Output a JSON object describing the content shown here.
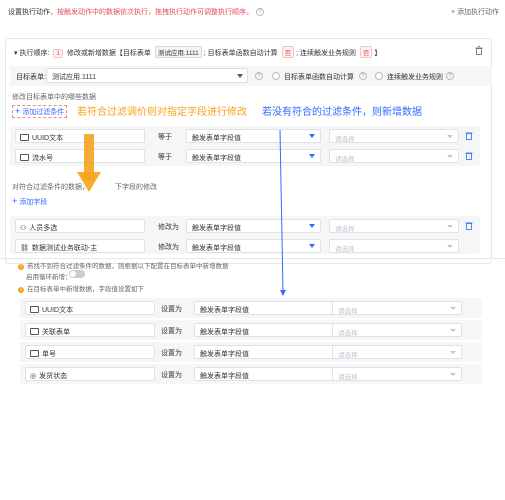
{
  "header": {
    "title": "设置执行动作",
    "warning": "，按触发动作中的数据依次执行，拖拽执行动作可调整执行顺序。",
    "add_action": "+ 添加执行动作"
  },
  "action": {
    "order_label": "执行顺序",
    "order_value": "1",
    "summary_prefix": "修改或新增数据【目标表单",
    "table_tag": "测试应用.1111",
    "summary_mid": "; 目标表单函数自动计算",
    "bool_tag": "否",
    "summary_mid2": "; 连续触发业务规则",
    "bool_tag2": "否",
    "summary_end": "】",
    "target_label": "目标表单:",
    "target_value": "测试应用.1111",
    "opt_calc": "目标表单函数自动计算",
    "opt_chain": "连续触发业务规则",
    "filter_label": "修改目标表单中的哪些数据",
    "add_filter": "添加过滤条件",
    "filters": [
      {
        "field": "UUID文本",
        "op": "等于",
        "value": "触发表单字段值",
        "placeholder": "请选择"
      },
      {
        "field": "流水号",
        "op": "等于",
        "value": "触发表单字段值",
        "placeholder": "请选择"
      }
    ],
    "modify_label": "对符合过滤条件的数据，",
    "modify_label2": "下字段的修改",
    "add_field": "添加字段",
    "mods": [
      {
        "field": "人员多选",
        "op": "修改为",
        "value": "触发表单字段值",
        "placeholder": "请选择"
      },
      {
        "field": "数据测试业务联动-主",
        "op": "修改为",
        "value": "触发表单字段值",
        "placeholder": "请选择"
      }
    ]
  },
  "bottom": {
    "line1": "若找不到符合过滤条件的数据，则根据以下配置在目标表单中新增数据",
    "loop_label": "启用循环新增：",
    "line2": "在目标表单中新增数据，字段值设置如下",
    "rows": [
      {
        "field": "UUID文本",
        "op": "设置为",
        "value": "触发表单字段值",
        "placeholder": "请选择"
      },
      {
        "field": "关联表单",
        "op": "设置为",
        "value": "触发表单字段值",
        "placeholder": "请选择"
      },
      {
        "field": "单号",
        "op": "设置为",
        "value": "触发表单字段值",
        "placeholder": "请选择"
      },
      {
        "field": "发货状态",
        "op": "设置为",
        "value": "触发表单字段值",
        "placeholder": "请选择"
      }
    ]
  },
  "annotations": {
    "orange": "若符合过滤调价则对指定字段进行修改",
    "blue": "若没有符合的过滤条件，则新增数据"
  },
  "colors": {
    "primary": "#2f6bff",
    "danger": "#e34d59",
    "annotation_orange": "#f7a21b"
  }
}
